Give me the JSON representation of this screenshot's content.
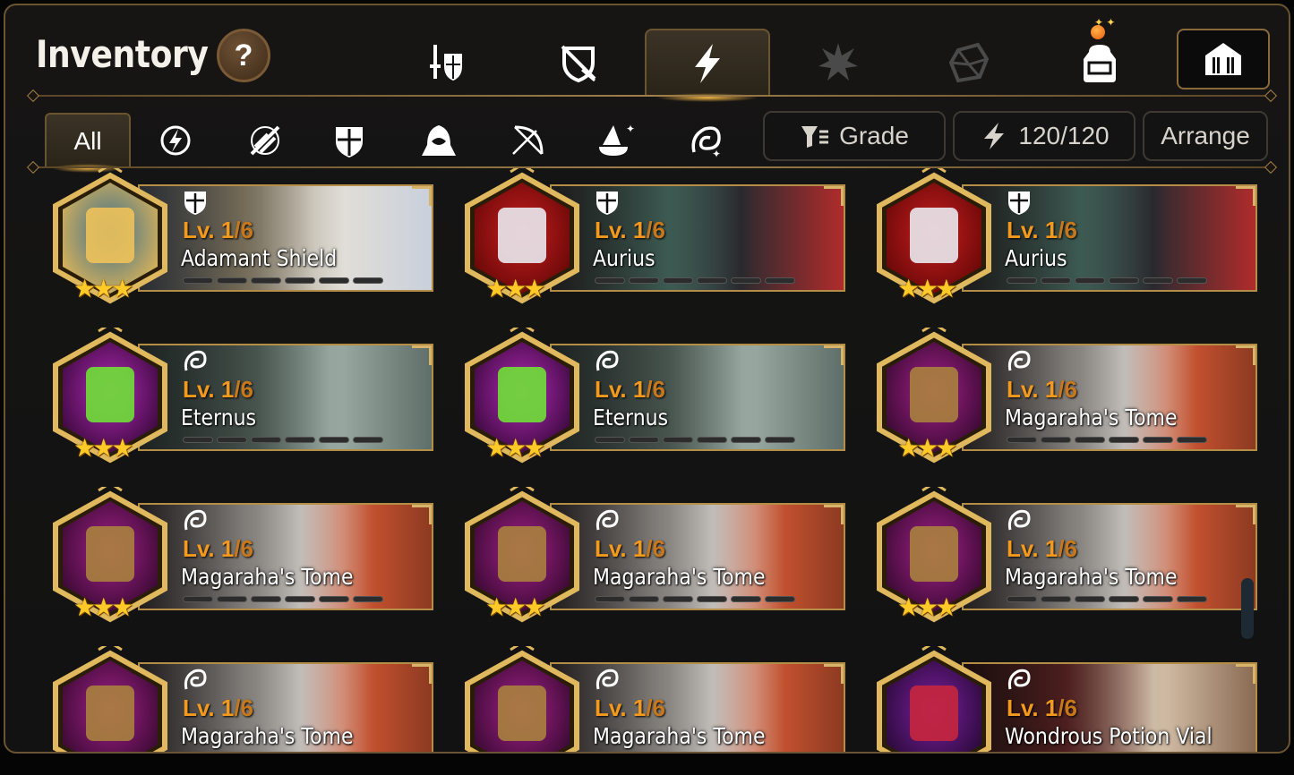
{
  "header": {
    "title": "Inventory",
    "help_label": "?"
  },
  "category_tabs": [
    {
      "name": "equipment",
      "icon": "sword-shield-icon",
      "active": false
    },
    {
      "name": "special-gear",
      "icon": "crossed-shield-icon",
      "active": false
    },
    {
      "name": "artifacts",
      "icon": "lightning-icon",
      "active": true
    },
    {
      "name": "materials",
      "icon": "burst-icon",
      "active": false
    },
    {
      "name": "catalysts",
      "icon": "crystal-icon",
      "active": false
    },
    {
      "name": "bag",
      "icon": "backpack-icon",
      "active": false,
      "has_notification": true
    }
  ],
  "filter_tabs": [
    {
      "label": "All",
      "icon": null,
      "active": true
    },
    {
      "label": "",
      "icon": "all-classes-icon",
      "active": false
    },
    {
      "label": "",
      "icon": "warrior-icon",
      "active": false
    },
    {
      "label": "",
      "icon": "knight-icon",
      "active": false
    },
    {
      "label": "",
      "icon": "thief-icon",
      "active": false
    },
    {
      "label": "",
      "icon": "ranger-icon",
      "active": false
    },
    {
      "label": "",
      "icon": "mage-icon",
      "active": false
    },
    {
      "label": "",
      "icon": "soul-weaver-icon",
      "active": false
    }
  ],
  "controls": {
    "grade_label": "Grade",
    "capacity_label": "120/120",
    "arrange_label": "Arrange"
  },
  "items": [
    {
      "name": "Adamant Shield",
      "level": "Lv. 1",
      "max": "/6",
      "class_icon": "knight-icon",
      "stars": "★★★",
      "theme": "shield"
    },
    {
      "name": "Aurius",
      "level": "Lv. 1",
      "max": "/6",
      "class_icon": "knight-icon",
      "stars": "★★★",
      "theme": "red"
    },
    {
      "name": "Aurius",
      "level": "Lv. 1",
      "max": "/6",
      "class_icon": "knight-icon",
      "stars": "★★★",
      "theme": "red"
    },
    {
      "name": "Eternus",
      "level": "Lv. 1",
      "max": "/6",
      "class_icon": "soul-weaver-icon",
      "stars": "★★★",
      "theme": "eye"
    },
    {
      "name": "Eternus",
      "level": "Lv. 1",
      "max": "/6",
      "class_icon": "soul-weaver-icon",
      "stars": "★★★",
      "theme": "eye"
    },
    {
      "name": "Magaraha's Tome",
      "level": "Lv. 1",
      "max": "/6",
      "class_icon": "soul-weaver-icon",
      "stars": "★★★",
      "theme": "tome"
    },
    {
      "name": "Magaraha's Tome",
      "level": "Lv. 1",
      "max": "/6",
      "class_icon": "soul-weaver-icon",
      "stars": "★★★",
      "theme": "tome"
    },
    {
      "name": "Magaraha's Tome",
      "level": "Lv. 1",
      "max": "/6",
      "class_icon": "soul-weaver-icon",
      "stars": "★★★",
      "theme": "tome"
    },
    {
      "name": "Magaraha's Tome",
      "level": "Lv. 1",
      "max": "/6",
      "class_icon": "soul-weaver-icon",
      "stars": "★★★",
      "theme": "tome"
    },
    {
      "name": "Magaraha's Tome",
      "level": "Lv. 1",
      "max": "/6",
      "class_icon": "soul-weaver-icon",
      "stars": "★★★",
      "theme": "tome"
    },
    {
      "name": "Magaraha's Tome",
      "level": "Lv. 1",
      "max": "/6",
      "class_icon": "soul-weaver-icon",
      "stars": "★★★",
      "theme": "tome"
    },
    {
      "name": "Wondrous Potion Vial",
      "level": "Lv. 1",
      "max": "/6",
      "class_icon": "soul-weaver-icon",
      "stars": "★★★",
      "theme": "potion"
    }
  ],
  "colors": {
    "accent_gold": "#b48d46",
    "level_orange": "#f39a1e",
    "frame": "#6b5430"
  }
}
